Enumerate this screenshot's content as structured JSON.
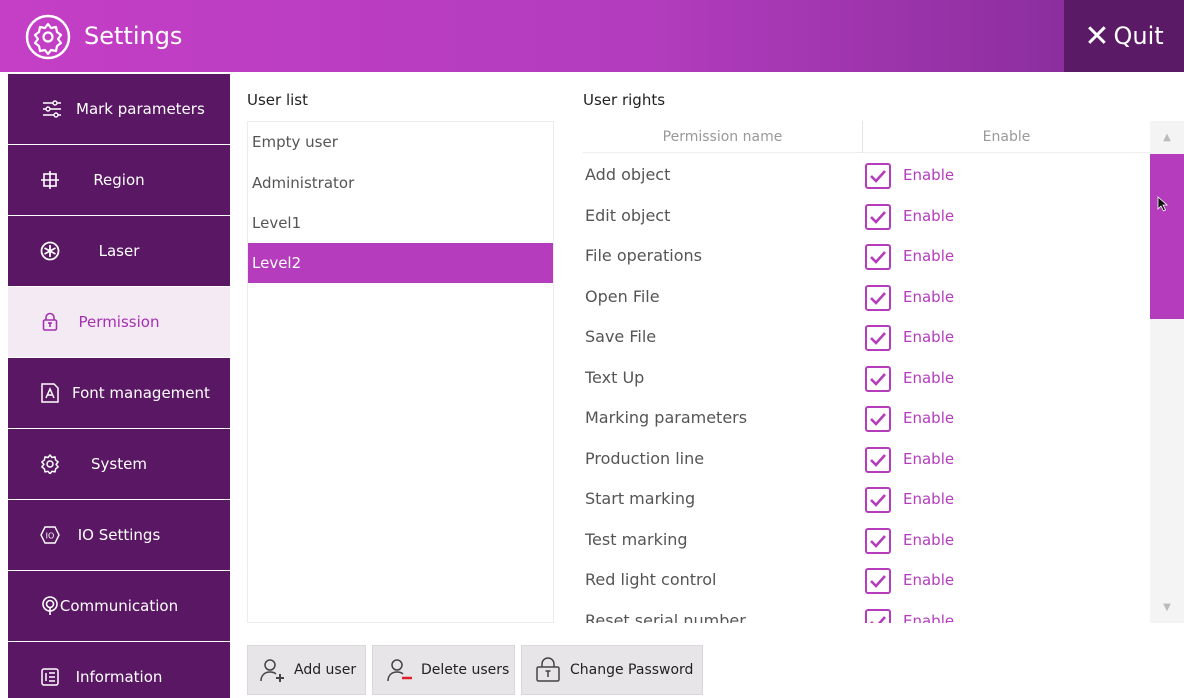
{
  "titlebar": {
    "title": "Settings",
    "quit_label": "Quit"
  },
  "sidebar": {
    "items": [
      {
        "label": "Mark parameters",
        "icon": "sliders-icon"
      },
      {
        "label": "Region",
        "icon": "region-icon"
      },
      {
        "label": "Laser",
        "icon": "laser-icon"
      },
      {
        "label": "Permission",
        "icon": "lock-icon",
        "active": true
      },
      {
        "label": "Font management",
        "icon": "font-icon"
      },
      {
        "label": "System",
        "icon": "gear-icon"
      },
      {
        "label": "IO Settings",
        "icon": "io-icon"
      },
      {
        "label": "Communication",
        "icon": "signal-icon"
      },
      {
        "label": "Information",
        "icon": "info-list-icon"
      }
    ]
  },
  "user_list": {
    "title": "User list",
    "users": [
      "Empty user",
      "Administrator",
      "Level1",
      "Level2"
    ],
    "selected": "Level2"
  },
  "user_rights": {
    "title": "User rights",
    "columns": [
      "Permission name",
      "Enable"
    ],
    "rows": [
      {
        "name": "Add object",
        "enabled": true,
        "enable_label": "Enable"
      },
      {
        "name": "Edit object",
        "enabled": true,
        "enable_label": "Enable"
      },
      {
        "name": "File operations",
        "enabled": true,
        "enable_label": "Enable"
      },
      {
        "name": "Open File",
        "enabled": true,
        "enable_label": "Enable"
      },
      {
        "name": "Save File",
        "enabled": true,
        "enable_label": "Enable"
      },
      {
        "name": "Text Up",
        "enabled": true,
        "enable_label": "Enable"
      },
      {
        "name": "Marking parameters",
        "enabled": true,
        "enable_label": "Enable"
      },
      {
        "name": "Production line",
        "enabled": true,
        "enable_label": "Enable"
      },
      {
        "name": "Start marking",
        "enabled": true,
        "enable_label": "Enable"
      },
      {
        "name": "Test marking",
        "enabled": true,
        "enable_label": "Enable"
      },
      {
        "name": "Red light control",
        "enabled": true,
        "enable_label": "Enable"
      },
      {
        "name": "Reset serial number",
        "enabled": true,
        "enable_label": "Enable"
      }
    ]
  },
  "buttons": {
    "add_user": "Add user",
    "delete_users": "Delete users",
    "change_password": "Change Password"
  },
  "colors": {
    "accent": "#b43cbd",
    "sidebar_bg": "#5a1864",
    "quit_bg": "#5b1a65",
    "active_bg": "#f3eaf4"
  }
}
